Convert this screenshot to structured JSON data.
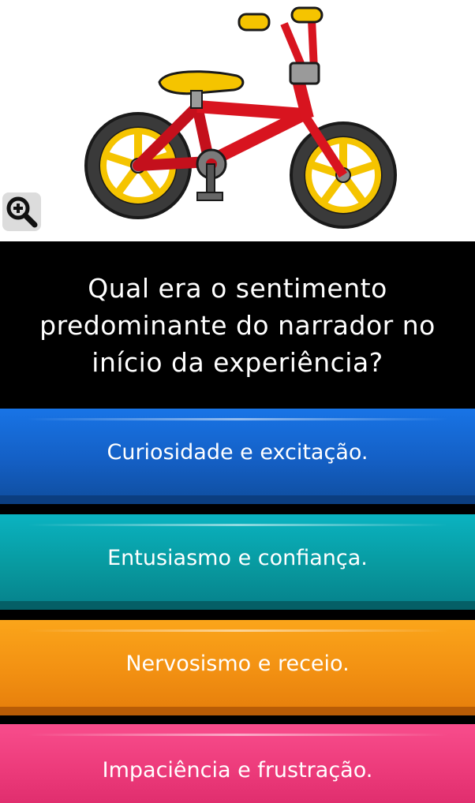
{
  "question": {
    "line1": "Qual era o sentimento",
    "line2": "predominante do narrador no",
    "line3": "início da experiência?"
  },
  "image": {
    "icon": "bicycle-illustration",
    "zoom_icon": "zoom-in-icon"
  },
  "answers": [
    {
      "label": "Curiosidade e excitação.",
      "color": "#145fc4"
    },
    {
      "label": "Entusiasmo e confiança.",
      "color": "#08999f"
    },
    {
      "label": "Nervosismo e receio.",
      "color": "#f29012"
    },
    {
      "label": "Impaciência e frustração.",
      "color": "#ec3a7a"
    }
  ]
}
